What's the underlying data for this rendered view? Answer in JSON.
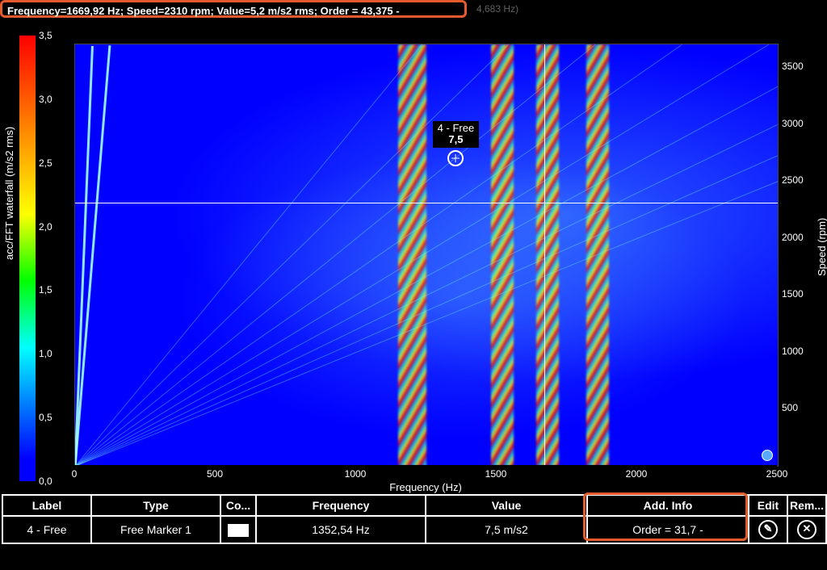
{
  "header": {
    "readout": "Frequency=1669,92 Hz; Speed=2310 rpm; Value=5,2 m/s2 rms; Order = 43,375 -",
    "extra": "4,683 Hz)"
  },
  "chart_data": {
    "type": "heatmap",
    "title": "",
    "xlabel": "Frequency (Hz)",
    "xlim": [
      0,
      2500
    ],
    "xticks": [
      0,
      500,
      1000,
      1500,
      2000,
      2500
    ],
    "right_ylabel": "Speed (rpm)",
    "right_ylim": [
      0,
      3700
    ],
    "right_yticks": [
      500,
      1000,
      1500,
      2000,
      2500,
      3000,
      3500
    ],
    "colorbar_label": "acc/FFT waterfall (m/s2 rms)",
    "colorbar_ticks": [
      0.0,
      0.5,
      1.0,
      1.5,
      2.0,
      2.5,
      3.0,
      3.5
    ],
    "cursor": {
      "frequency_hz": 1669.92,
      "speed_rpm": 2310,
      "value": 5.2,
      "unit": "m/s2 rms",
      "order": 43.375
    },
    "markers": [
      {
        "id": 4,
        "label": "4 - Free",
        "value_text": "7,5",
        "frequency_hz": 1352.54,
        "speed_rpm": 2700,
        "value": 7.5,
        "unit": "m/s2",
        "order": 31.7
      }
    ],
    "prominent_order_lines": [
      1,
      2,
      20,
      25,
      30,
      35,
      40,
      45,
      50,
      55,
      60
    ],
    "resonance_bands_hz": [
      [
        1150,
        1250
      ],
      [
        1480,
        1560
      ],
      [
        1640,
        1720
      ],
      [
        1820,
        1900
      ]
    ]
  },
  "table": {
    "headers": {
      "label": "Label",
      "type": "Type",
      "color": "Co...",
      "freq": "Frequency",
      "value": "Value",
      "add": "Add. Info",
      "edit": "Edit",
      "rem": "Rem..."
    },
    "rows": [
      {
        "label": "4 - Free",
        "type": "Free Marker 1",
        "color": "#ffffff",
        "freq": "1352,54 Hz",
        "value": "7,5 m/s2",
        "add": "Order = 31,7 -"
      }
    ]
  }
}
